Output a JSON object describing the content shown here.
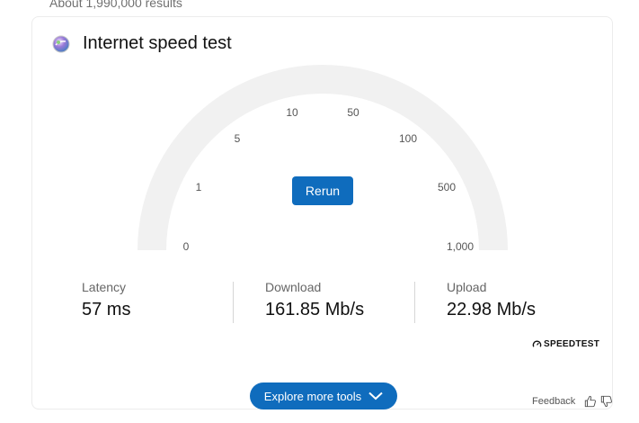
{
  "results_count": "About 1,990,000 results",
  "card": {
    "title": "Internet speed test",
    "icon": "speed-test-globe-icon"
  },
  "gauge": {
    "labels": [
      "0",
      "1",
      "5",
      "10",
      "50",
      "100",
      "500",
      "1,000"
    ]
  },
  "rerun_label": "Rerun",
  "stats": {
    "latency": {
      "label": "Latency",
      "value": "57 ms"
    },
    "download": {
      "label": "Download",
      "value": "161.85 Mb/s"
    },
    "upload": {
      "label": "Upload",
      "value": "22.98 Mb/s"
    }
  },
  "provider": "SPEEDTEST",
  "explore_label": "Explore more tools",
  "feedback_label": "Feedback",
  "colors": {
    "accent": "#0f6cbd",
    "gauge_track": "#f1f1f1"
  }
}
